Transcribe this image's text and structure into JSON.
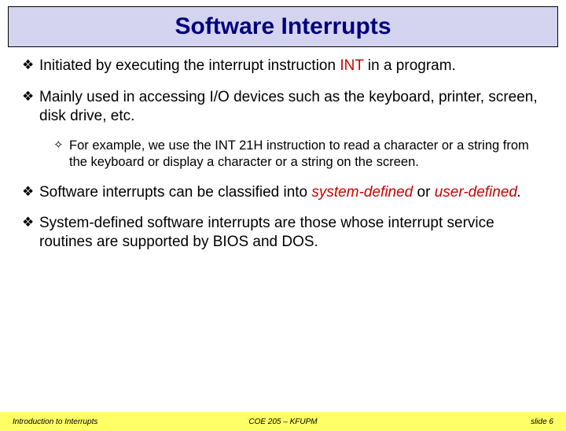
{
  "title": "Software Interrupts",
  "bullets": [
    {
      "level": 1,
      "pre": "Initiated by executing the interrupt instruction ",
      "int": "INT",
      "post": " in a program."
    },
    {
      "level": 1,
      "pre": "Mainly used in accessing I/O devices such as the keyboard, printer, screen, disk drive, etc."
    },
    {
      "level": 2,
      "pre": "For example, we use the INT 21H instruction to read a character or a string from the keyboard or display a character or a string on the screen."
    },
    {
      "level": 1,
      "pre": "Software interrupts can be classified into ",
      "italicRed1": "system-defined",
      "mid": " or ",
      "italicRed2": "user-defined",
      "post2": "."
    },
    {
      "level": 1,
      "pre": "System-defined software interrupts are those whose interrupt service routines are supported by BIOS and DOS."
    }
  ],
  "footer": {
    "left": "Introduction to Interrupts",
    "center": "COE 205 – KFUPM",
    "right": "slide 6"
  }
}
